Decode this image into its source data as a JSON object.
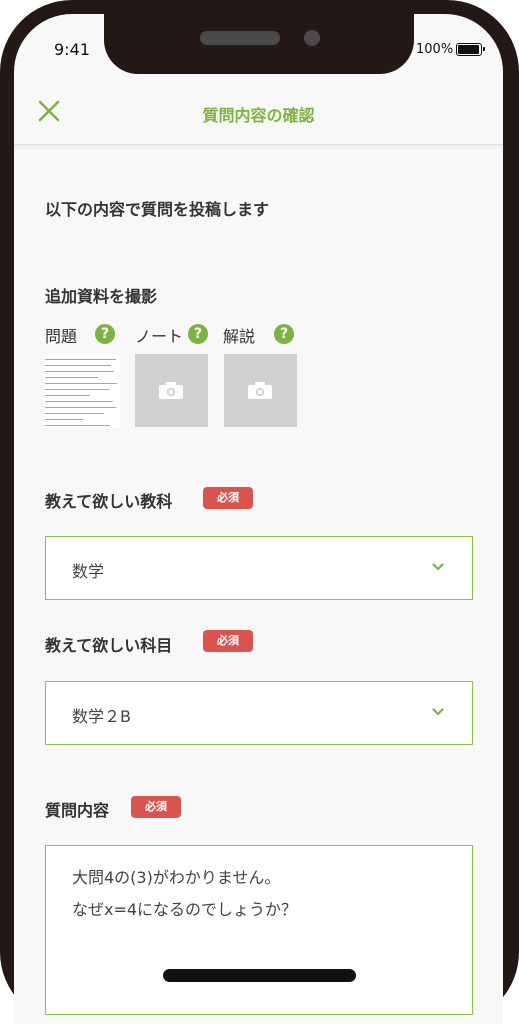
{
  "status_bar": {
    "time": "9:41",
    "battery_label": "100%",
    "battery_level": 1.0
  },
  "header": {
    "title": "質問内容の確認",
    "close_icon": "close-icon"
  },
  "intro": {
    "text": "以下の内容で質問を投稿します"
  },
  "attachments": {
    "heading": "追加資料を撮影",
    "items": [
      {
        "label": "問題",
        "state": "photo"
      },
      {
        "label": "ノート",
        "state": "empty"
      },
      {
        "label": "解説",
        "state": "empty"
      }
    ],
    "help_icon": "?"
  },
  "subject": {
    "label": "教えて欲しい教科",
    "badge": "必須",
    "value": "数学"
  },
  "course": {
    "label": "教えて欲しい科目",
    "badge": "必須",
    "value": "数学２B"
  },
  "question": {
    "label": "質問内容",
    "badge": "必須",
    "lines": [
      "大問4の(3)がわかりません。",
      "なぜx=4になるのでしょうか？"
    ]
  },
  "colors": {
    "accent": "#7cb342",
    "required_badge": "#d9534f",
    "frame": "#231815"
  }
}
